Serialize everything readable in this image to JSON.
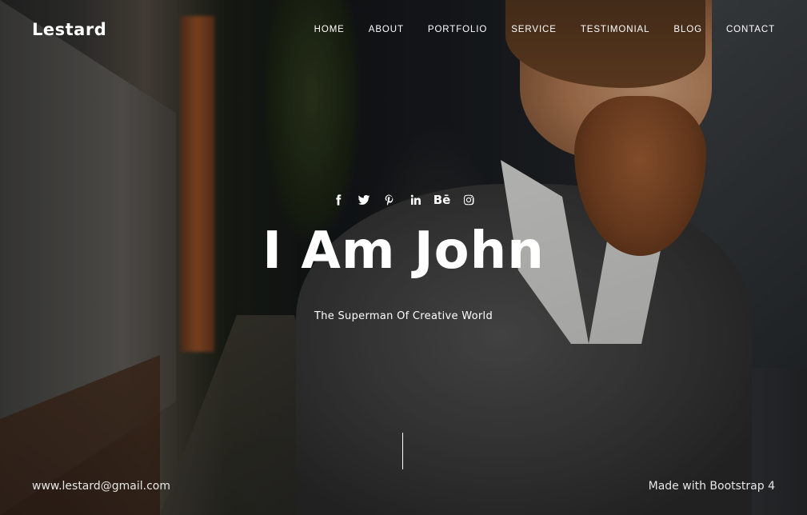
{
  "brand": {
    "name": "Lestard"
  },
  "nav": {
    "items": [
      {
        "label": "HOME"
      },
      {
        "label": "ABOUT"
      },
      {
        "label": "PORTFOLIO"
      },
      {
        "label": "SERVICE"
      },
      {
        "label": "TESTIMONIAL"
      },
      {
        "label": "BLOG"
      },
      {
        "label": "CONTACT"
      }
    ]
  },
  "hero": {
    "social": [
      {
        "icon": "facebook-icon"
      },
      {
        "icon": "twitter-icon"
      },
      {
        "icon": "pinterest-icon"
      },
      {
        "icon": "linkedin-icon"
      },
      {
        "icon": "behance-icon",
        "glyph": "Bē"
      },
      {
        "icon": "instagram-icon"
      }
    ],
    "title": "I Am John",
    "subtitle": "The Superman Of Creative World"
  },
  "footer": {
    "email": "www.lestard@gmail.com",
    "credit": "Made with Bootstrap 4"
  },
  "colors": {
    "text": "#ffffff",
    "overlay": "rgba(0,0,0,0.28)"
  }
}
